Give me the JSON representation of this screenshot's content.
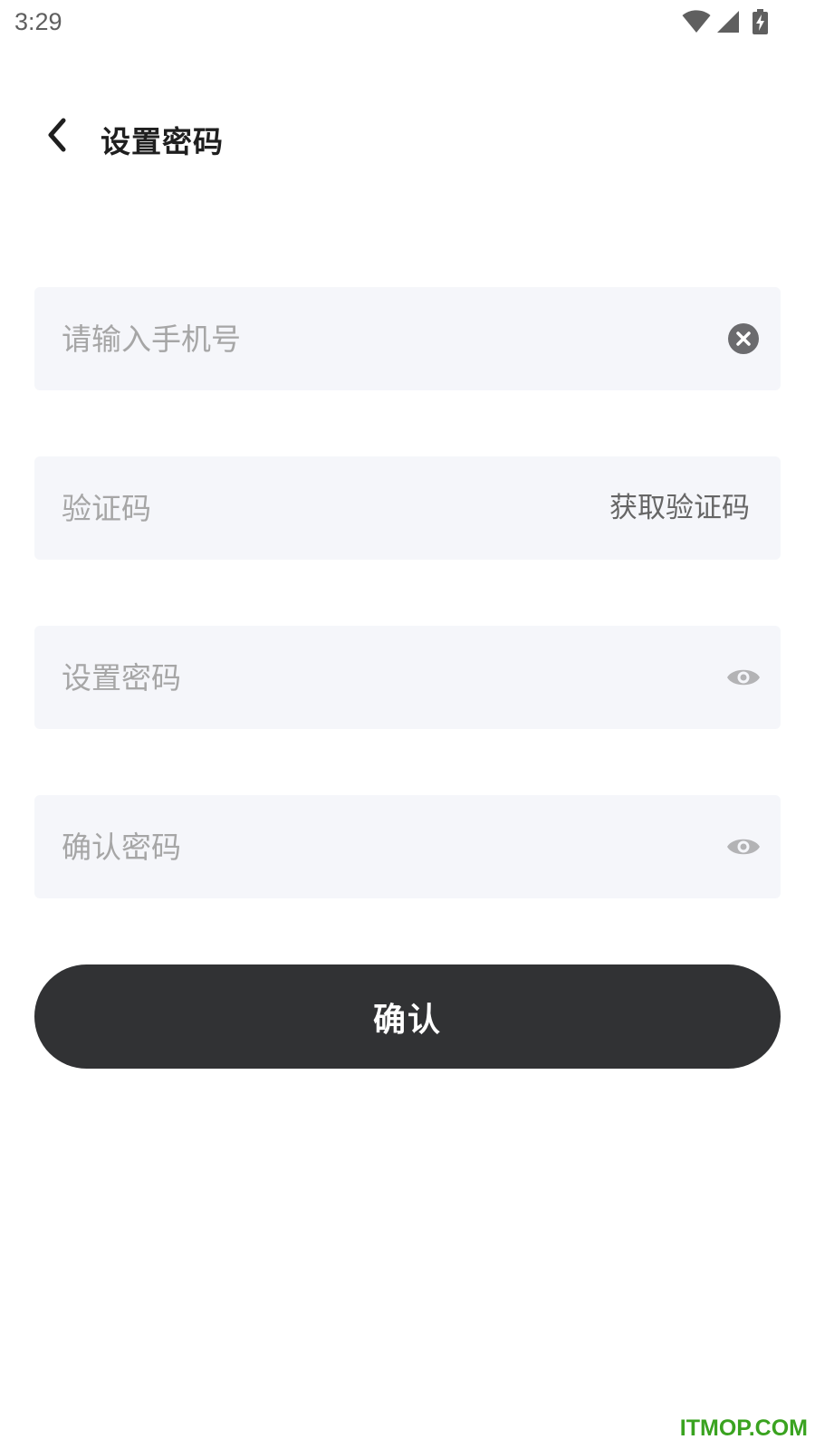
{
  "status_bar": {
    "time": "3:29",
    "icons": [
      "wifi-icon",
      "cellular-signal-icon",
      "battery-charging-icon"
    ]
  },
  "header": {
    "back_icon": "chevron-left-icon",
    "title": "设置密码"
  },
  "form": {
    "phone": {
      "value": "",
      "placeholder": "请输入手机号",
      "action_icon": "clear-circle-icon"
    },
    "code": {
      "value": "",
      "placeholder": "验证码",
      "action_label": "获取验证码"
    },
    "password": {
      "value": "",
      "placeholder": "设置密码",
      "action_icon": "eye-icon"
    },
    "confirm_password": {
      "value": "",
      "placeholder": "确认密码",
      "action_icon": "eye-icon"
    }
  },
  "confirm_button": {
    "label": "确认"
  },
  "watermark": {
    "text": "ITMOP.COM"
  },
  "colors": {
    "field_background": "#f5f6fa",
    "button_background": "#313234",
    "placeholder": "#a6a6a6",
    "watermark": "#3aa320"
  }
}
